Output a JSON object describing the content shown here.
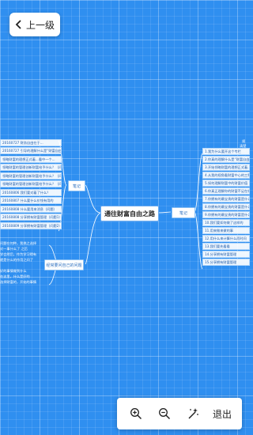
{
  "header": {
    "back_label": "上一级"
  },
  "mindmap": {
    "center_title": "通往财富自由之路",
    "branch_left_top": "笔记",
    "branch_right": "笔记",
    "branch_left_bottom": "经常要问自己的问题",
    "left_top_leaves": [
      "20160727 财务自由在于...",
      "20160727 引导的理解什么是“财富自由”",
      "领略财富的理想正式着...看中一个...",
      "领略财富的管理创新财富给予什么？（问题1）",
      "领略财富的管理创新财富给予什么？（问题2）",
      "领略财富的管理创新财富给予什么？（问题3）",
      "20160806 我们要对着了什么？",
      "20160807 什么要什么价钱有用的",
      "20160808 什么要用来消息（问题）",
      "20160808 分享拥有财富管理（问题1）",
      "20160809 分享拥有财富管理（问题2）"
    ],
    "right_leaves": [
      "1.我为什么要开这个专栏",
      "2.你真的理解什么是“财富自由”吗",
      "3.开始领略财富的理想正式着...看中一个",
      "4.从我的视角看财富中心的三种选择",
      "5.如何理解财富中的财富价值",
      "6.你真正理解你的财富不足在哪吗",
      "7.你拥有的最宝贵的财富是什么？",
      "8.你拥有的最宝贵的财富是什么？",
      "9.你拥有的最宝贵的财富是什么？",
      "10.我们要如何做了这样的",
      "11.用来做来做的事",
      "12.用什么来计算什么而时间",
      "13.我们要先看看",
      "14.分享拥有财富管理",
      "15.分享拥有财富管理"
    ],
    "right_side_text": [
      "规",
      "清楚",
      "...",
      "...",
      "..."
    ],
    "left_bottom_text": [
      "问题在何种，我挑之选择",
      "对一事什么了 之后",
      "学会然后，作为学习得有",
      "就是什么的作用之间了",
      "好的事情做到什么",
      "在这里，什么是好的",
      "选择财富的，开始的事情"
    ]
  },
  "toolbar": {
    "zoom_in_icon": "zoom-in-icon",
    "zoom_out_icon": "zoom-out-icon",
    "magic_icon": "magic-wand-icon",
    "exit_label": "退出"
  }
}
